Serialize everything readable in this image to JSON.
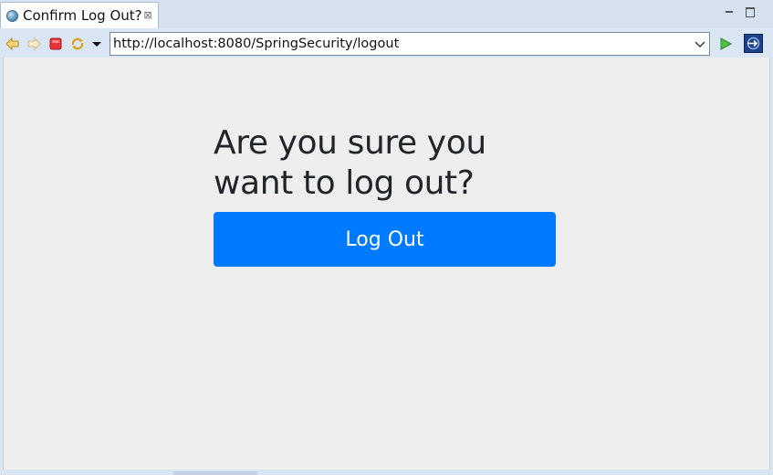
{
  "tab": {
    "title": "Confirm Log Out?",
    "icon": "globe-icon",
    "close_icon": "close-icon",
    "close_glyph": "⊠"
  },
  "window_controls": {
    "minimize_icon": "minimize-icon",
    "maximize_icon": "maximize-icon"
  },
  "toolbar": {
    "icons": [
      "back-icon",
      "forward-icon",
      "stop-icon",
      "refresh-icon",
      "dropdown-icon"
    ],
    "url": "http://localhost:8080/SpringSecurity/logout",
    "go_icon": "go-icon",
    "external_browser_icon": "external-browser-icon"
  },
  "page": {
    "heading": "Are you sure you want to log out?",
    "button_label": "Log Out",
    "colors": {
      "button_bg": "#007bff",
      "button_text": "#ffffff",
      "heading_text": "#212529",
      "page_bg": "#eeeeee"
    }
  }
}
